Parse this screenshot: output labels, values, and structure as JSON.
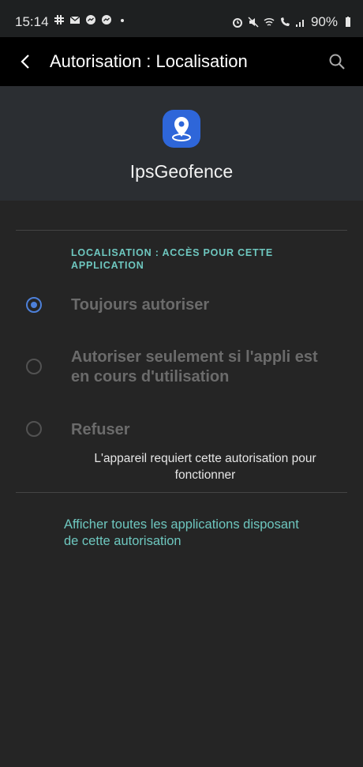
{
  "status_bar": {
    "time": "15:14",
    "battery": "90%",
    "notification_icons": [
      "slack-icon",
      "mail-icon",
      "messenger-icon",
      "messenger-icon",
      "dot-icon"
    ],
    "system_icons": [
      "alarm-icon",
      "mute-icon",
      "wifi-icon",
      "wifi-call-icon",
      "signal-icon",
      "battery-icon"
    ]
  },
  "appbar": {
    "title": "Autorisation : Localisation"
  },
  "app": {
    "name": "IpsGeofence",
    "icon_color": "#2e66d9"
  },
  "permission": {
    "section_label": "LOCALISATION : ACCÈS POUR CETTE APPLICATION",
    "options": [
      {
        "label": "Toujours autoriser",
        "selected": true
      },
      {
        "label": "Autoriser seulement si l'appli est en cours d'utilisation",
        "selected": false
      },
      {
        "label": "Refuser",
        "selected": false
      }
    ],
    "note": "L'appareil requiert cette autorisation pour fonctionner"
  },
  "link": {
    "label": "Afficher toutes les applications disposant de cette autorisation"
  },
  "colors": {
    "accent": "#6ec7bf",
    "radio_selected": "#4d80d9"
  }
}
